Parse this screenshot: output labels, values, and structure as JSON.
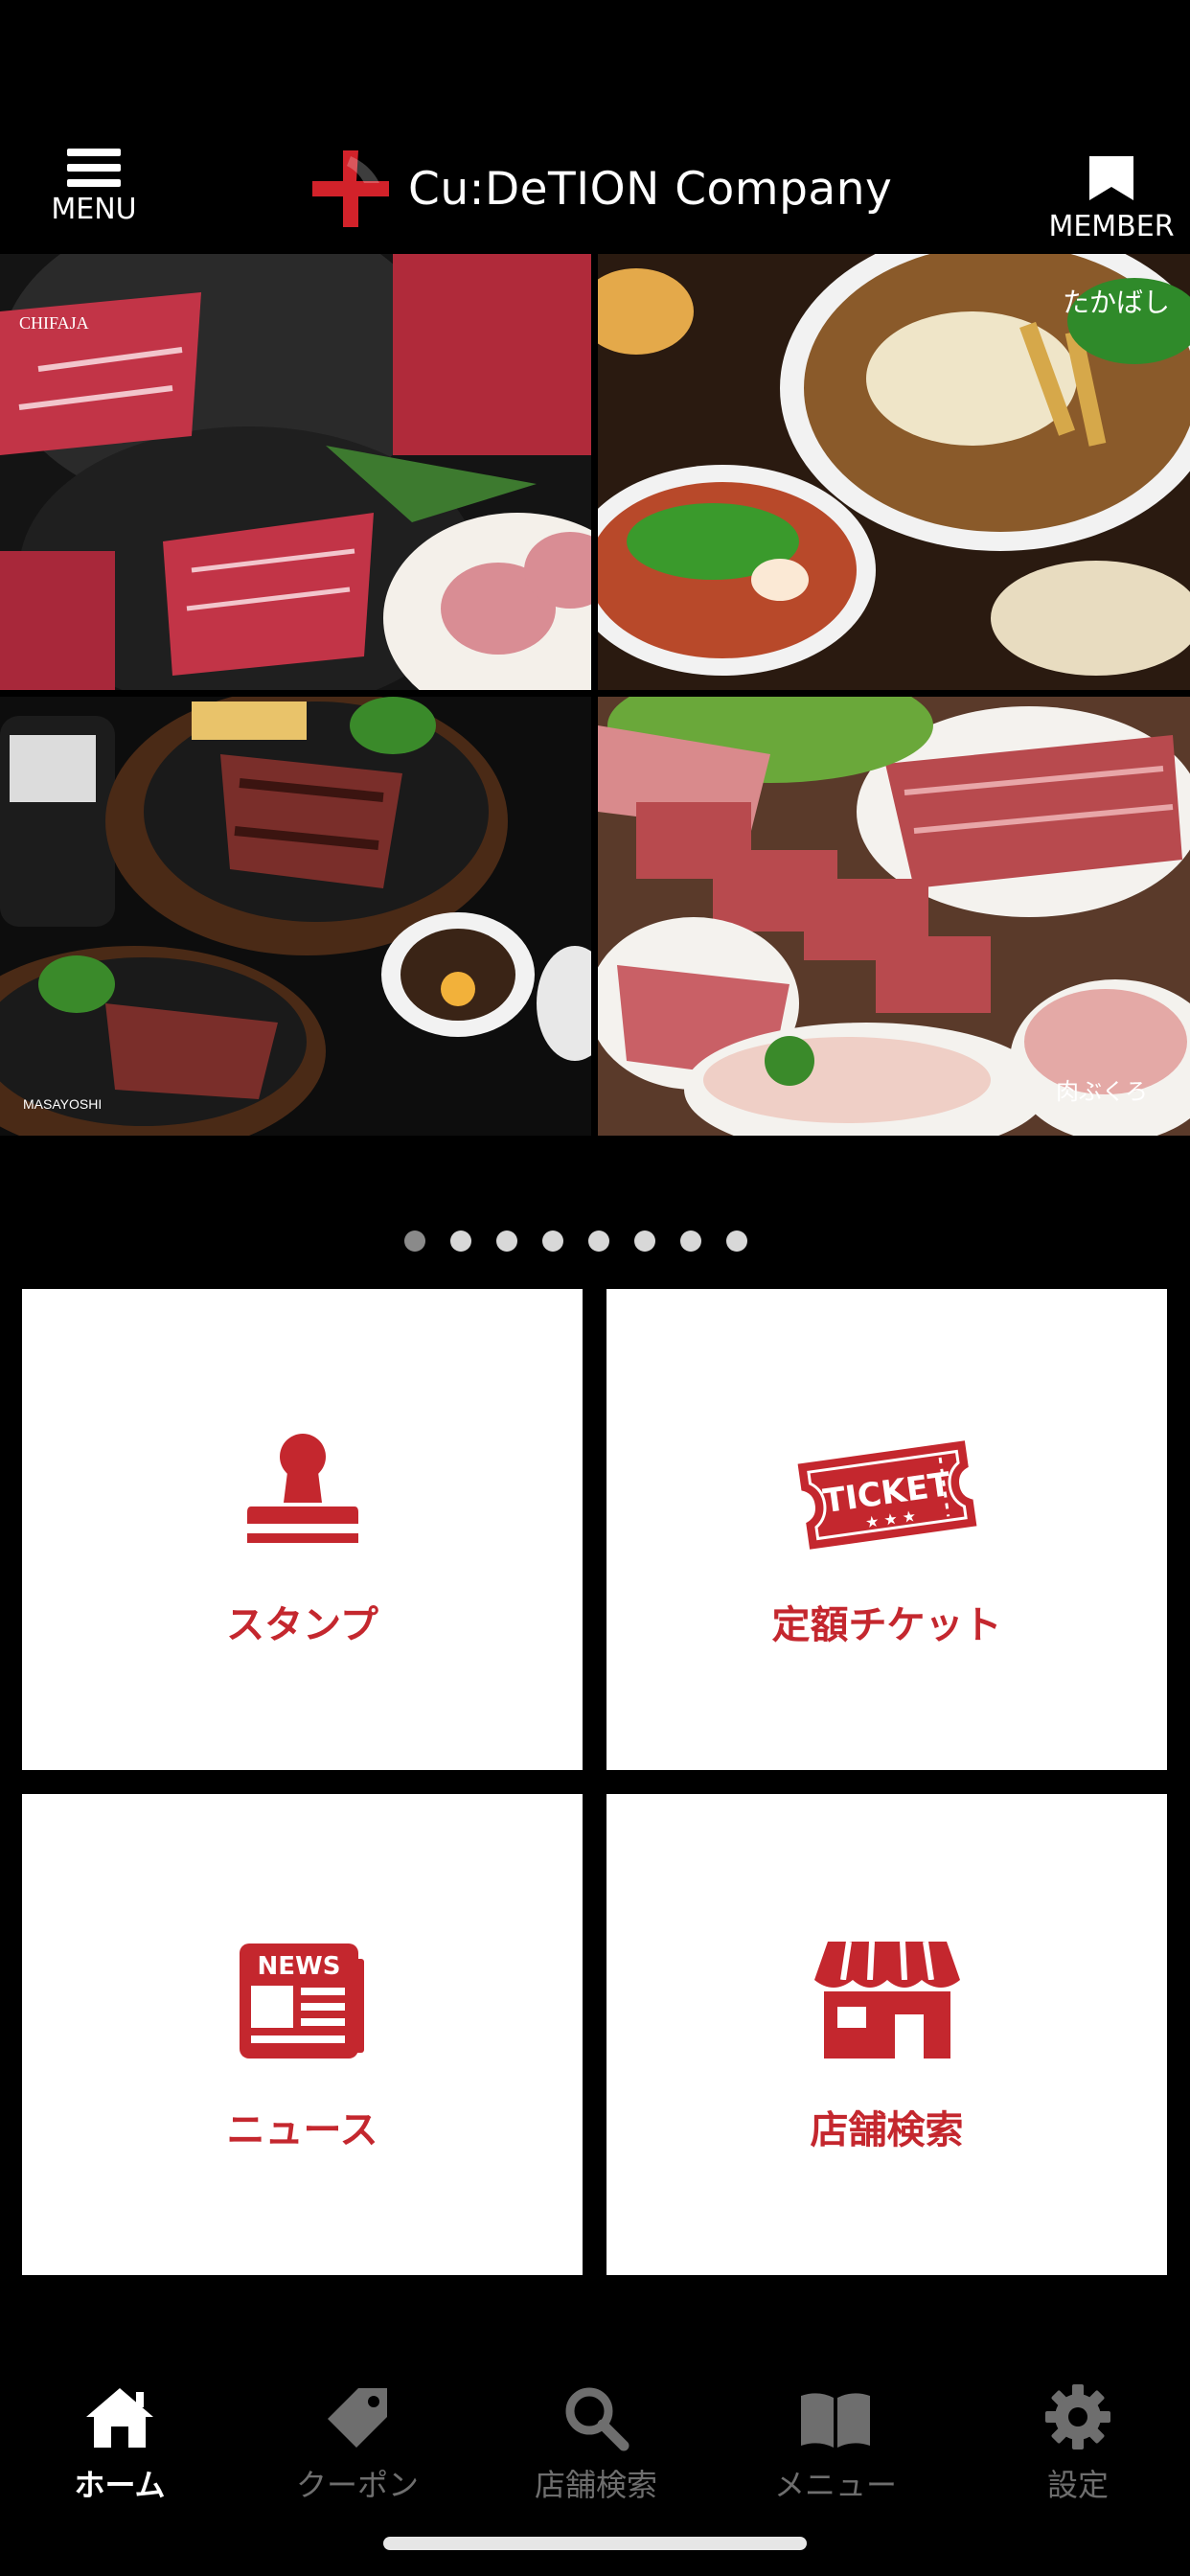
{
  "header": {
    "menu_label": "MENU",
    "member_label": "MEMBER",
    "logo_text": "Cu:DeTION Company"
  },
  "slider": {
    "tiles": [
      {
        "logo_text": "CHIFAJA"
      },
      {
        "logo_text": "たかばし"
      },
      {
        "logo_text": "MASAYOSHI"
      },
      {
        "logo_text": "肉ぶくろ"
      }
    ],
    "dot_count": 8,
    "active_index": 0
  },
  "features": [
    {
      "label": "スタンプ",
      "icon": "stamp-icon"
    },
    {
      "label": "定額チケット",
      "icon": "ticket-icon",
      "icon_text": "TICKET"
    },
    {
      "label": "ニュース",
      "icon": "news-icon",
      "icon_text": "NEWS"
    },
    {
      "label": "店舗検索",
      "icon": "store-icon"
    }
  ],
  "tabbar": {
    "tabs": [
      {
        "label": "ホーム",
        "icon": "home-icon",
        "active": true
      },
      {
        "label": "クーポン",
        "icon": "tag-icon",
        "active": false
      },
      {
        "label": "店舗検索",
        "icon": "search-icon",
        "active": false
      },
      {
        "label": "メニュー",
        "icon": "book-icon",
        "active": false
      },
      {
        "label": "設定",
        "icon": "gear-icon",
        "active": false
      }
    ]
  },
  "colors": {
    "accent": "#c4272e",
    "background": "#000000",
    "card": "#ffffff",
    "tab_inactive": "#6e6e6e"
  }
}
